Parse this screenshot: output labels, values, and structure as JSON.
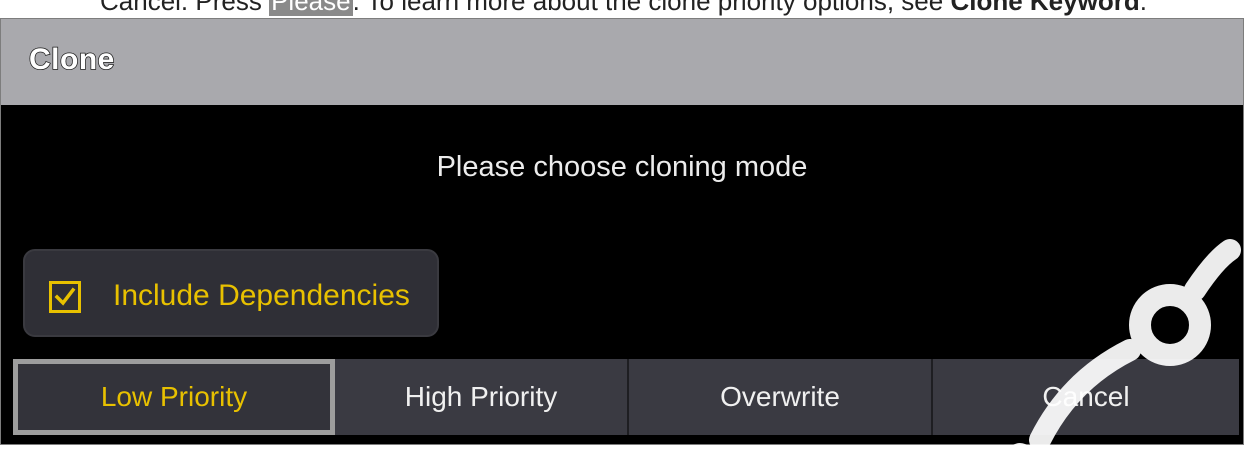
{
  "doc_text": {
    "before": "Cancel. Press ",
    "highlight": "Please",
    "middle": ". To learn more about the clone priority options, see ",
    "link": "Clone Keyword",
    "after": "."
  },
  "dialog": {
    "title": "Clone",
    "message": "Please choose cloning mode",
    "checkbox": {
      "label": "Include Dependencies",
      "checked": true,
      "icon": "checkmark-icon"
    },
    "buttons": [
      {
        "label": "Low Priority",
        "selected": true
      },
      {
        "label": "High Priority",
        "selected": false
      },
      {
        "label": "Overwrite",
        "selected": false
      },
      {
        "label": "Cancel",
        "selected": false
      }
    ]
  },
  "colors": {
    "title_bar": "#a9a9ad",
    "dialog_bg": "#000000",
    "button_bg": "#3a3a42",
    "accent_yellow": "#e8c100",
    "selected_border": "#9d9d9d"
  }
}
